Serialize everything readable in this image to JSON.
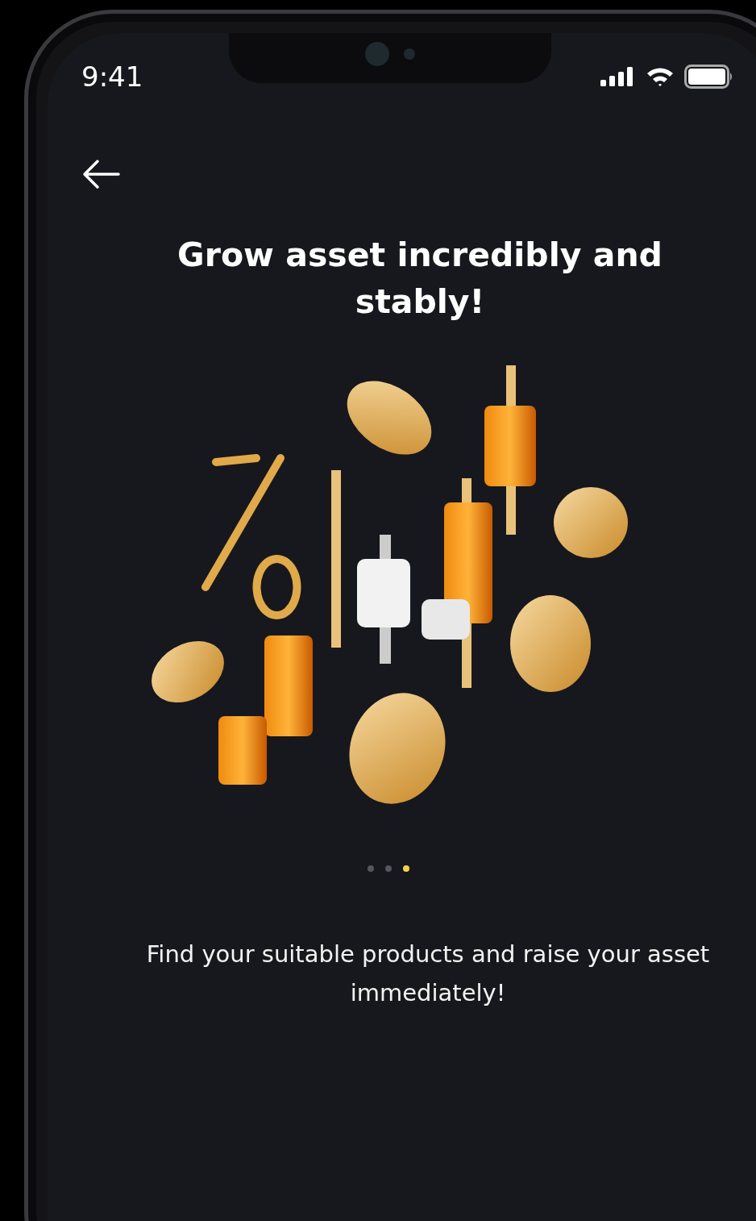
{
  "status_bar": {
    "time": "9:41"
  },
  "title": "Grow asset incredibly and stably!",
  "pager": [
    {
      "selected": false
    },
    {
      "selected": false
    },
    {
      "selected": true
    }
  ],
  "description": "Find your suitable products and raise your asset immediately!"
}
